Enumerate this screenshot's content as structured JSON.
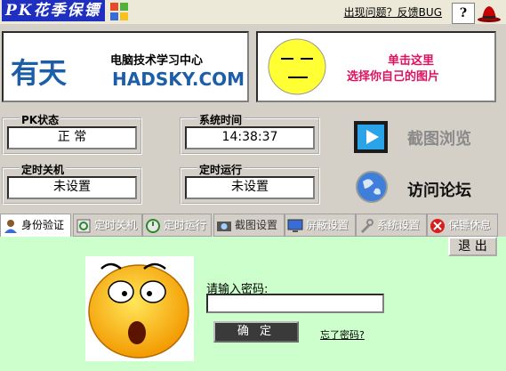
{
  "titlebar": {
    "app_logo_text": "PK花季保镖",
    "report_link": "出现问题？反馈BUG",
    "help_label": "?"
  },
  "banner_left": {
    "logo_text": "有天",
    "line1": "电脑技术学习中心",
    "line2": "HADSKY.COM"
  },
  "banner_right": {
    "line1": "单击这里",
    "line2": "选择你自己的图片"
  },
  "status": {
    "pk_status_title": "PK状态",
    "pk_status_value": "正 常",
    "system_time_title": "系统时间",
    "system_time_value": "14:38:37",
    "shutdown_title": "定时关机",
    "shutdown_value": "未设置",
    "run_title": "定时运行",
    "run_value": "未设置"
  },
  "actions": {
    "screenshot_browse": "截图浏览",
    "visit_forum": "访问论坛"
  },
  "tabs": [
    {
      "label": "身份验证",
      "icon": "person-icon",
      "active": true
    },
    {
      "label": "定时关机",
      "icon": "shutdown-icon",
      "active": false
    },
    {
      "label": "定时运行",
      "icon": "run-icon",
      "active": false
    },
    {
      "label": "截图设置",
      "icon": "screenshot-icon",
      "active": false
    },
    {
      "label": "屏蔽设置",
      "icon": "monitor-icon",
      "active": false
    },
    {
      "label": "系统设置",
      "icon": "wrench-icon",
      "active": false
    },
    {
      "label": "保镖休息",
      "icon": "stop-icon",
      "active": false
    }
  ],
  "content": {
    "exit_label": "退 出",
    "password_label": "请输入密码:",
    "password_value": "",
    "ok_label": "确 定",
    "forgot_link": "忘了密码?"
  }
}
